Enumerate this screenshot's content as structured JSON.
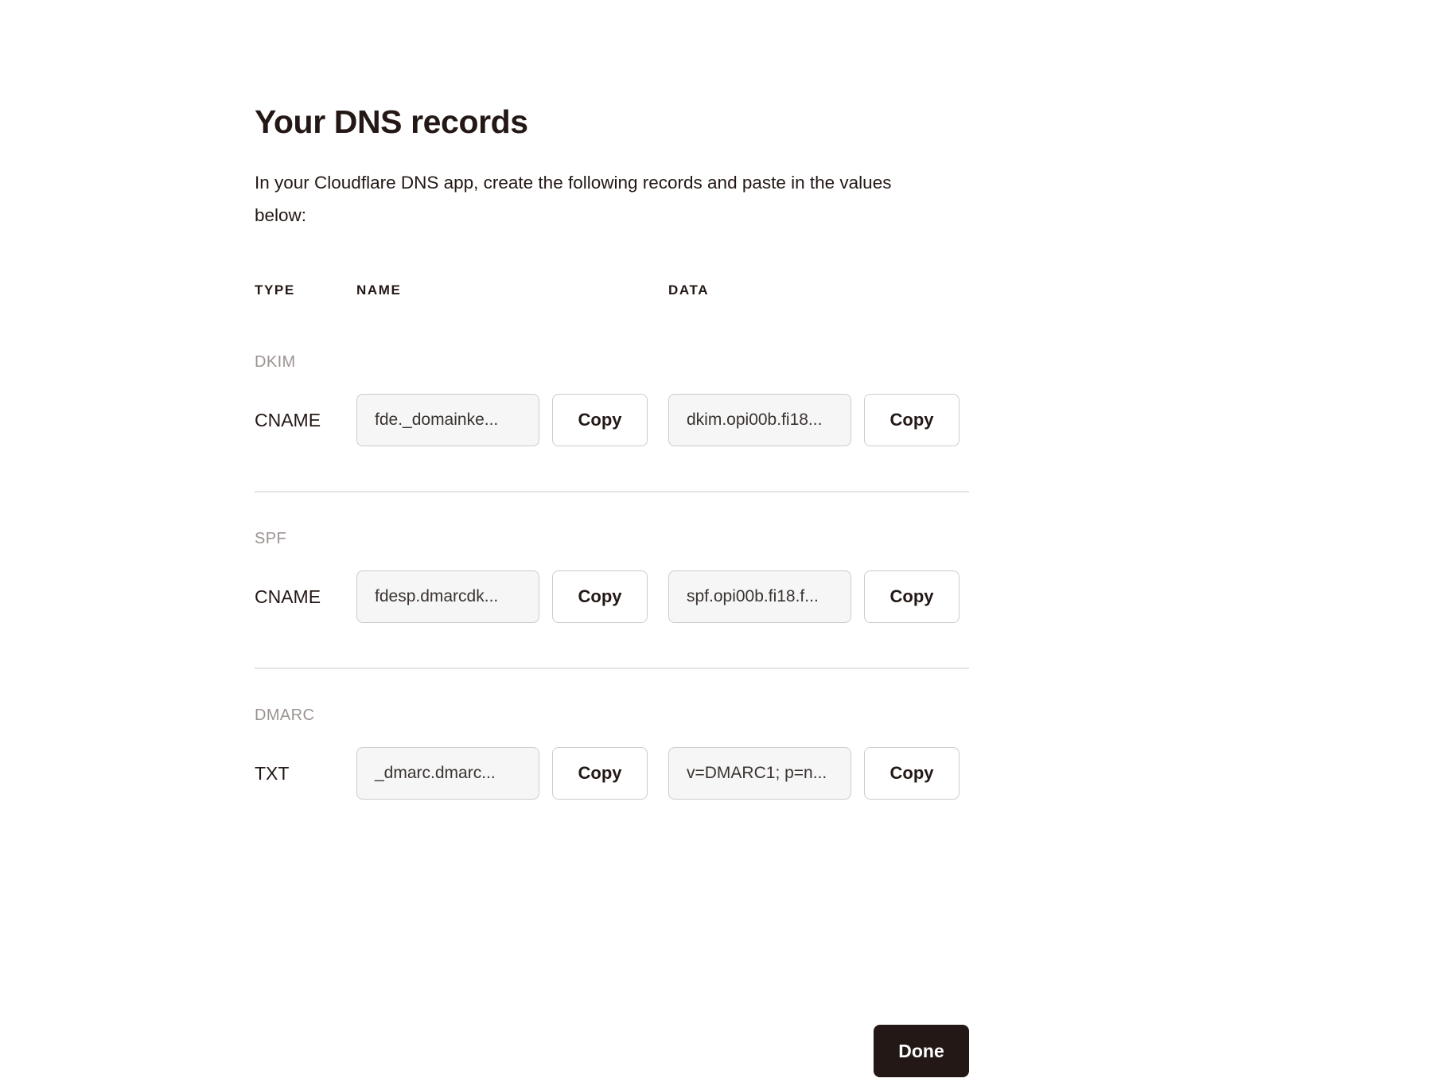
{
  "page": {
    "title": "Your DNS records",
    "intro": "In your Cloudflare DNS app, create the following records and paste in the values below:"
  },
  "table": {
    "headers": {
      "type": "TYPE",
      "name": "NAME",
      "data": "DATA"
    },
    "sections": [
      {
        "label": "DKIM",
        "record": {
          "type": "CNAME",
          "name_value": "fde._domainke...",
          "name_copy_label": "Copy",
          "data_value": "dkim.opi00b.fi18...",
          "data_copy_label": "Copy"
        }
      },
      {
        "label": "SPF",
        "record": {
          "type": "CNAME",
          "name_value": "fdesp.dmarcdk...",
          "name_copy_label": "Copy",
          "data_value": "spf.opi00b.fi18.f...",
          "data_copy_label": "Copy"
        }
      },
      {
        "label": "DMARC",
        "record": {
          "type": "TXT",
          "name_value": "_dmarc.dmarc...",
          "name_copy_label": "Copy",
          "data_value": "v=DMARC1; p=n...",
          "data_copy_label": "Copy"
        }
      }
    ]
  },
  "footer": {
    "done_label": "Done"
  },
  "colors": {
    "text": "#231815",
    "muted": "#9b9391",
    "field_bg": "#f6f6f6",
    "border": "#cfcbca",
    "divider": "#e5e4e3",
    "primary_button_bg": "#231815"
  }
}
